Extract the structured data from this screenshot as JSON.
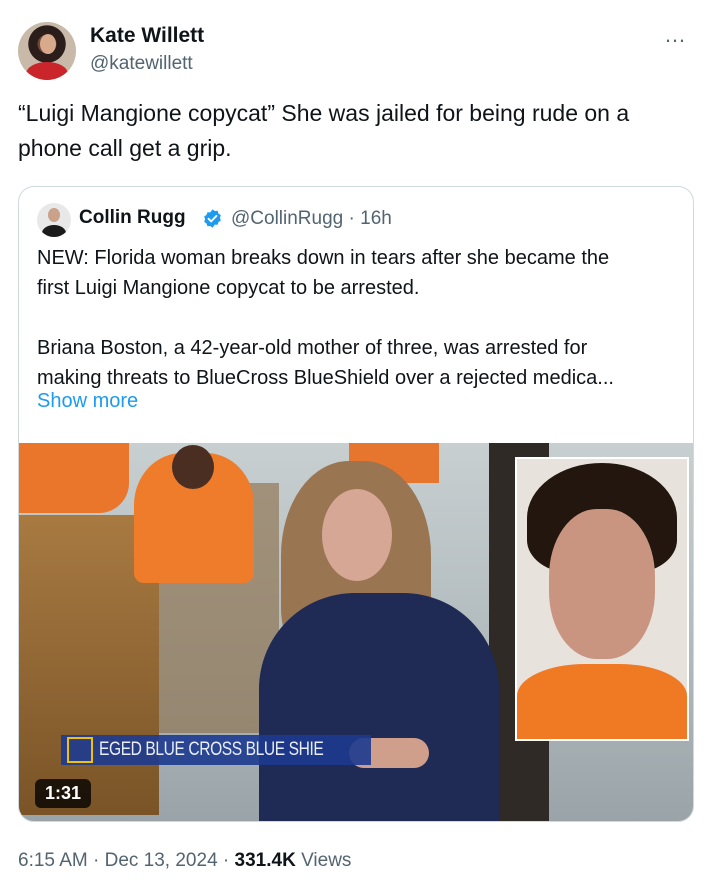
{
  "tweet": {
    "author_name": "Kate Willett",
    "author_handle": "@katewillett",
    "text_line1": "“Luigi Mangione copycat” She was jailed for being rude on a",
    "text_line2": "phone call get a grip.",
    "more_icon": "…"
  },
  "quote": {
    "author_name": "Collin Rugg",
    "author_handle": "@CollinRugg",
    "time": "· 16h",
    "verified_icon": "verified-badge-icon",
    "para1_line1": "NEW: Florida woman breaks down in tears after she became the",
    "para1_line2": "first Luigi Mangione copycat to be arrested.",
    "para2_line1": "Briana Boston, a 42-year-old mother of three, was arrested for",
    "para2_line2": "making threats to BlueCross BlueShield over a rejected medica...",
    "show_more": "Show more",
    "media": {
      "chyron": "EGED BLUE CROSS BLUE SHIE",
      "duration": "1:31"
    }
  },
  "meta": {
    "time": "6:15 AM",
    "sep1": " · ",
    "date": "Dec 13, 2024",
    "sep2": " · ",
    "views_count": "331.4K",
    "views_label": " Views"
  },
  "colors": {
    "accent": "#1d9bf0",
    "text": "#0f1419",
    "secondary": "#536471",
    "border": "#cfd9de"
  }
}
